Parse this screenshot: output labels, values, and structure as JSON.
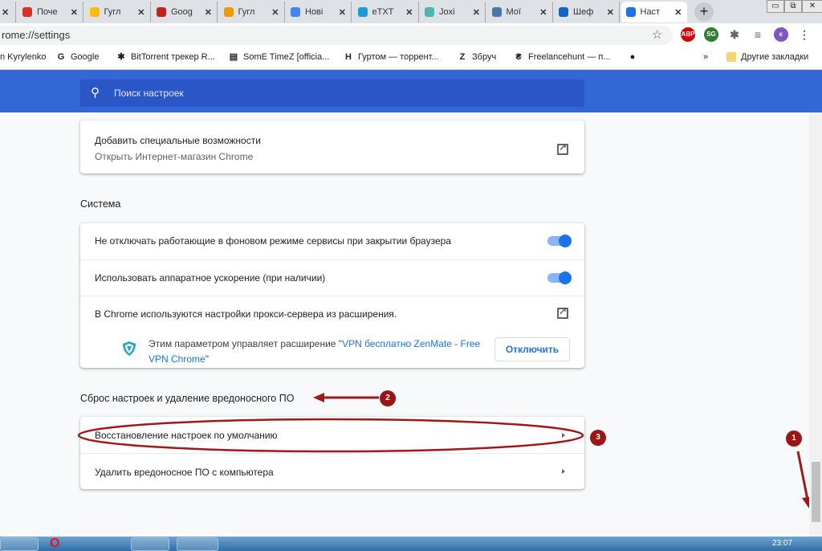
{
  "tabs": [
    {
      "title": "Поче",
      "color": "#d93025"
    },
    {
      "title": "Гугл",
      "color": "#fbbc04"
    },
    {
      "title": "Goog",
      "color": "#c5221f"
    },
    {
      "title": "Гугл",
      "color": "#f29900"
    },
    {
      "title": "Нові",
      "color": "#4285f4"
    },
    {
      "title": "eTXT",
      "color": "#1a9bd7"
    },
    {
      "title": "Joxi",
      "color": "#4db6ac"
    },
    {
      "title": "Мої",
      "color": "#4a76a8"
    },
    {
      "title": "Шеф",
      "color": "#1565c0"
    },
    {
      "title": "Наст",
      "color": "#1a73e8"
    }
  ],
  "new_tab": "+",
  "window_controls": [
    "▭",
    "⧉",
    "✕"
  ],
  "address": "rome://settings",
  "extensions": [
    {
      "label": "ABP",
      "color": "#d50000"
    },
    {
      "label": "SG",
      "color": "#2e7d32"
    },
    {
      "label": "✱",
      "color": "#5f6368"
    },
    {
      "label": "≡",
      "color": "#5f6368"
    },
    {
      "label": "є",
      "color": "#7e57c2"
    },
    {
      "label": "⋮",
      "color": "#5f6368"
    }
  ],
  "bookmarks": [
    {
      "label": "n Kyrylenko",
      "icon": ""
    },
    {
      "label": "Google",
      "icon": "G"
    },
    {
      "label": "BitTorrent трекер R...",
      "icon": "✱"
    },
    {
      "label": "SomE TimeZ [officia...",
      "icon": "▤"
    },
    {
      "label": "Гуртом — торрент...",
      "icon": "H"
    },
    {
      "label": "Збруч",
      "icon": "Z"
    },
    {
      "label": "Freelancehunt — п...",
      "icon": "₴"
    },
    {
      "label": "",
      "icon": "●"
    }
  ],
  "bookmarks_more": "»",
  "other_bookmarks": "Другие закладки",
  "search_placeholder": "Поиск настроек",
  "accessibility": {
    "title": "Добавить специальные возможности",
    "subtitle": "Открыть Интернет-магазин Chrome"
  },
  "system": {
    "heading": "Система",
    "background": "Не отключать работающие в фоновом режиме сервисы при закрытии браузера",
    "background_on": true,
    "hardware": "Использовать аппаратное ускорение (при наличии)",
    "hardware_on": true,
    "proxy": "В Chrome используются настройки прокси-сервера из расширения.",
    "managed_prefix": "Этим параметром управляет расширение \"",
    "managed_ext1": "VPN бесплатно ZenMate - Free",
    "managed_ext2": "VPN Chrome",
    "managed_suffix": "\"",
    "disable_button": "Отключить"
  },
  "reset": {
    "heading": "Сброс настроек и удаление вредоносного ПО",
    "restore": "Восстановление настроек по умолчанию",
    "cleanup": "Удалить вредоносное ПО с компьютера"
  },
  "annotations": [
    "1",
    "2",
    "3"
  ],
  "clock": "23:07"
}
